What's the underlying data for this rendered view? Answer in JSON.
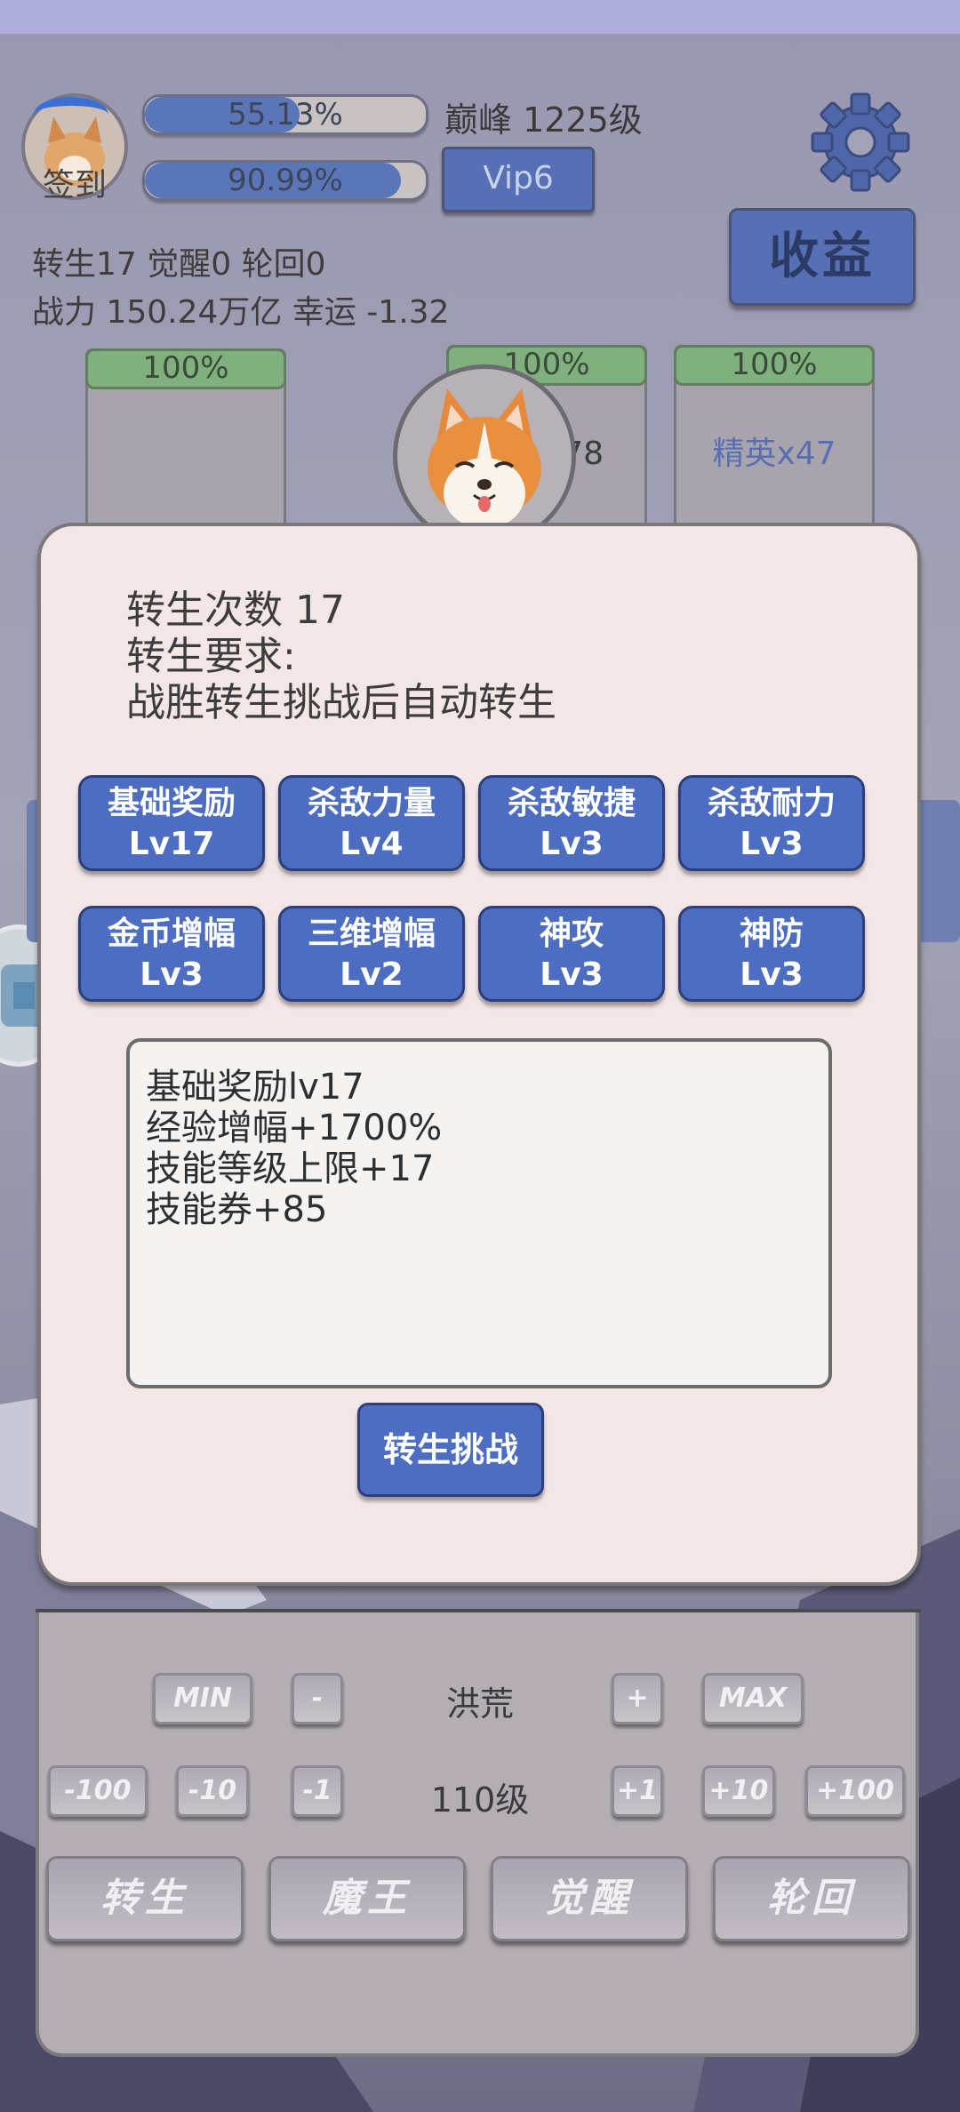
{
  "header": {
    "signin_label": "签到",
    "progress1": {
      "value": 0.5513,
      "label": "55.13%"
    },
    "progress2": {
      "value": 0.9099,
      "label": "90.99%"
    },
    "peak_level": "巅峰 1225级",
    "vip_label": "Vip6",
    "earnings_label": "收益",
    "stats_line1": "转生17 觉醒0 轮回0",
    "stats_line2": "战力 150.24万亿  幸运 -1.32",
    "settings_icon": "gear-icon"
  },
  "cards": [
    {
      "percent": "100%",
      "label": ""
    },
    {
      "percent": "100%",
      "label": "怪x78"
    },
    {
      "percent": "100%",
      "label": "精英x47"
    }
  ],
  "dialog": {
    "line1": "转生次数 17",
    "line2": "转生要求:",
    "line3": "战胜转生挑战后自动转生",
    "skills": [
      {
        "name": "基础奖励",
        "level": "Lv17"
      },
      {
        "name": "杀敌力量",
        "level": "Lv4"
      },
      {
        "name": "杀敌敏捷",
        "level": "Lv3"
      },
      {
        "name": "杀敌耐力",
        "level": "Lv3"
      },
      {
        "name": "金币增幅",
        "level": "Lv3"
      },
      {
        "name": "三维增幅",
        "level": "Lv2"
      },
      {
        "name": "神攻",
        "level": "Lv3"
      },
      {
        "name": "神防",
        "level": "Lv3"
      }
    ],
    "description": [
      "基础奖励lv17",
      "经验增幅+1700%",
      "技能等级上限+17",
      "技能券+85"
    ],
    "challenge_label": "转生挑战"
  },
  "bottom": {
    "row1": {
      "min": "MIN",
      "minus": "-",
      "zone": "洪荒",
      "plus": "+",
      "max": "MAX"
    },
    "row2": {
      "m100": "-100",
      "m10": "-10",
      "m1": "-1",
      "level": "110级",
      "p1": "+1",
      "p10": "+10",
      "p100": "+100"
    },
    "actions": [
      "转生",
      "魔王",
      "觉醒",
      "轮回"
    ]
  },
  "colors": {
    "accent": "#4d6dc2",
    "dialog_bg": "#f3e6e7",
    "progress_fill": "#5b76b8",
    "percent_green": "#7fb07d"
  }
}
